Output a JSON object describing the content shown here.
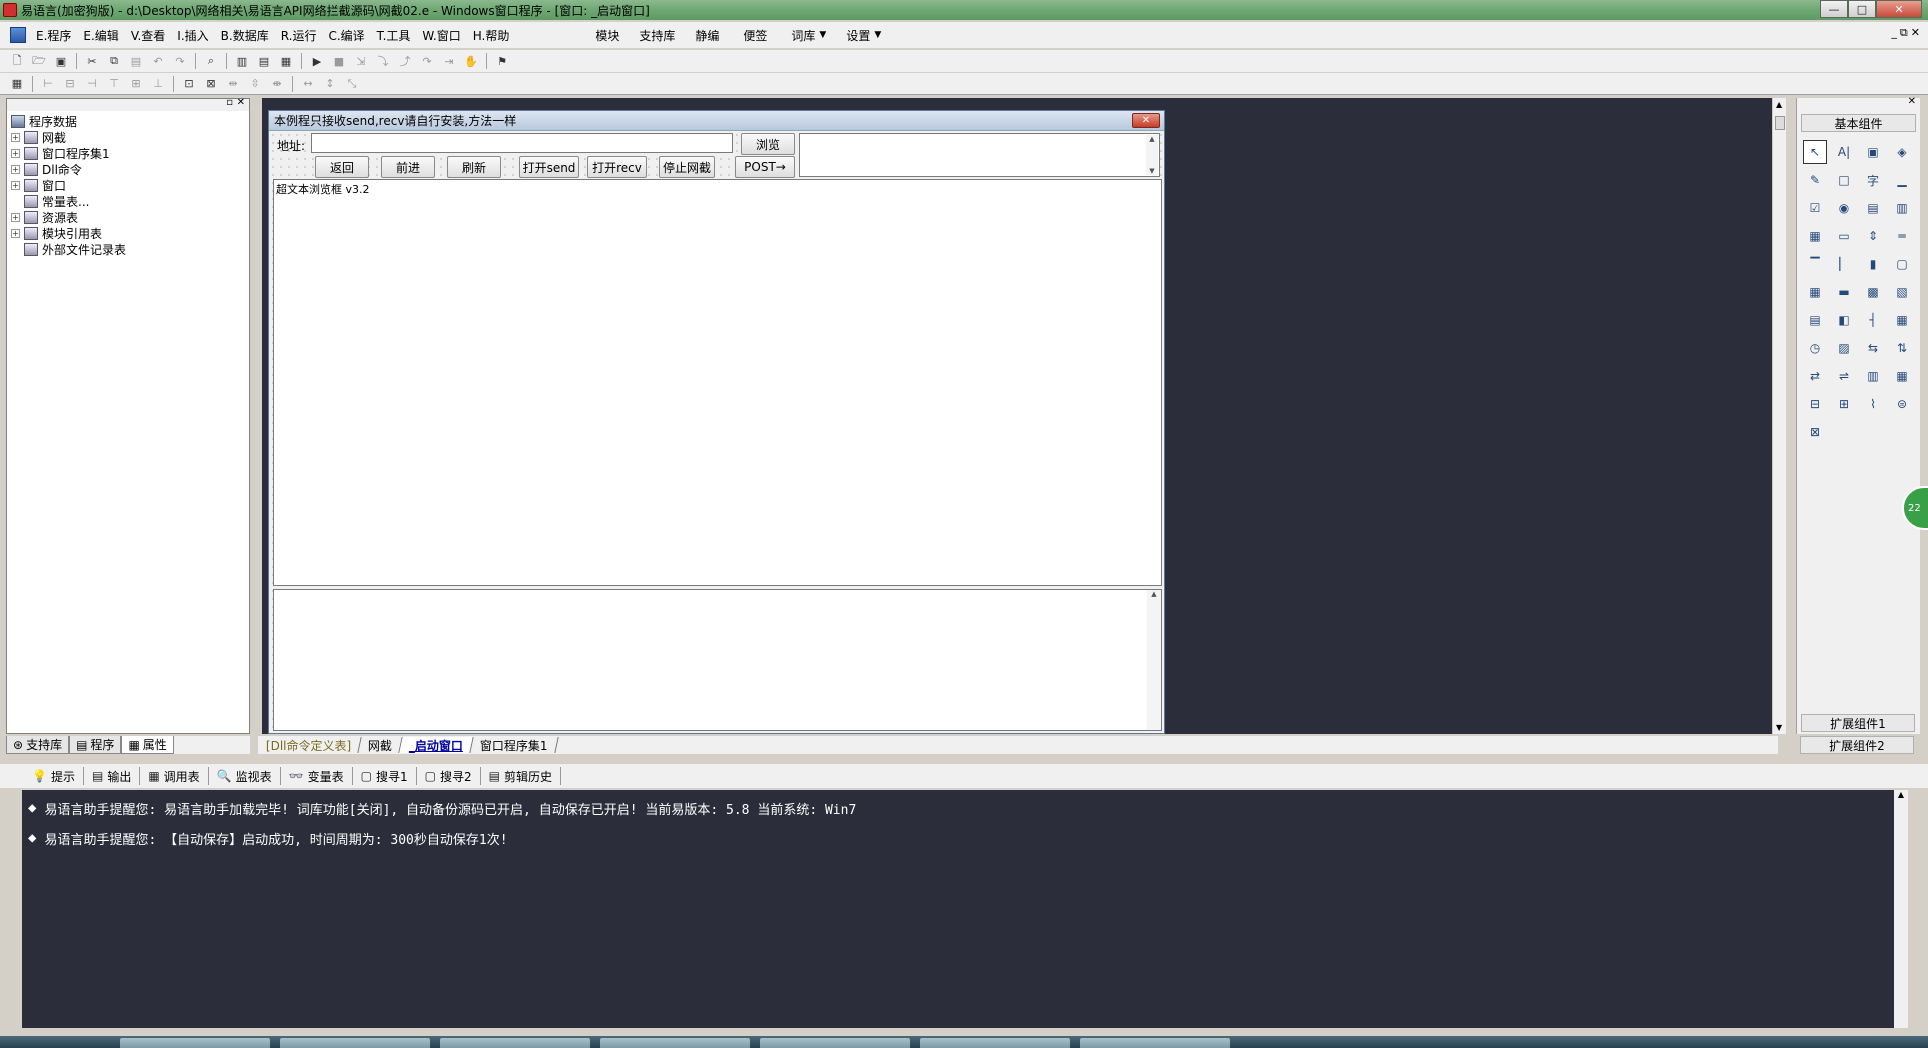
{
  "titlebar": {
    "title": "易语言(加密狗版) - d:\\Desktop\\网络相关\\易语言API网络拦截源码\\网截02.e - Windows窗口程序 - [窗口: _启动窗口]",
    "min": "—",
    "max": "□",
    "close": "✕"
  },
  "menubar": {
    "left": [
      "E.程序",
      "E.编辑",
      "V.查看",
      "I.插入",
      "B.数据库",
      "R.运行",
      "C.编译",
      "T.工具",
      "W.窗口",
      "H.帮助"
    ],
    "right": [
      "模块",
      "支持库",
      "静编",
      "便签",
      "词库",
      "设置"
    ],
    "mdi": [
      "_",
      "⧉",
      "✕"
    ]
  },
  "left_panel": {
    "tree": [
      {
        "label": "程序数据",
        "level": 0,
        "expander": ""
      },
      {
        "label": "网截",
        "level": 1,
        "expander": "+"
      },
      {
        "label": "窗口程序集1",
        "level": 1,
        "expander": "+"
      },
      {
        "label": "Dll命令",
        "level": 1,
        "expander": "+"
      },
      {
        "label": "窗口",
        "level": 1,
        "expander": "+"
      },
      {
        "label": "常量表...",
        "level": 1,
        "expander": ""
      },
      {
        "label": "资源表",
        "level": 1,
        "expander": "+"
      },
      {
        "label": "模块引用表",
        "level": 1,
        "expander": "+"
      },
      {
        "label": "外部文件记录表",
        "level": 1,
        "expander": ""
      }
    ],
    "tabs": [
      "支持库",
      "程序",
      "属性"
    ]
  },
  "form": {
    "title": "本例程只接收send,recv请自行安装,方法一样",
    "close": "✕",
    "address_label": "地址:",
    "address_value": "",
    "browse_button": "浏览",
    "buttons": [
      "返回",
      "前进",
      "刷新",
      "打开send",
      "打开recv",
      "停止网截",
      "POST→"
    ],
    "browser_text": "超文本浏览框 v3.2"
  },
  "toolbox": {
    "group_basic": "基本组件",
    "ext1": "扩展组件1",
    "ext2": "扩展组件2",
    "tools": [
      "↖",
      "A|",
      "▣",
      "◈",
      "✎",
      "□",
      "字",
      "▁",
      "☑",
      "◉",
      "▤",
      "▥",
      "▦",
      "▭",
      "⇕",
      "═",
      "▔",
      "▏",
      "▮",
      "▢",
      "▦",
      "▬",
      "▩",
      "▧",
      "▤",
      "◧",
      "┤",
      "▦",
      "◷",
      "▨",
      "⇆",
      "⇅",
      "⇄",
      "⇌",
      "▥",
      "▦",
      "⊟",
      "⊞",
      "⌇",
      "⊜",
      "⊠"
    ]
  },
  "doc_tabs": [
    "[Dll命令定义表]",
    "网截",
    "_启动窗口",
    "窗口程序集1"
  ],
  "output": {
    "tabs": [
      "提示",
      "输出",
      "调用表",
      "监视表",
      "变量表",
      "搜寻1",
      "搜寻2",
      "剪辑历史"
    ],
    "tab_icons": [
      "💡",
      "▤",
      "▦",
      "🔍",
      "👓",
      "▢",
      "▢",
      "▤"
    ],
    "lines": [
      "易语言助手提醒您:  易语言助手加载完毕! 词库功能[关闭], 自动备份源码已开启, 自动保存已开启! 当前易版本: 5.8  当前系统: Win7",
      "易语言助手提醒您: 【自动保存】启动成功, 时间周期为: 300秒自动保存1次!"
    ]
  },
  "badge": "22"
}
